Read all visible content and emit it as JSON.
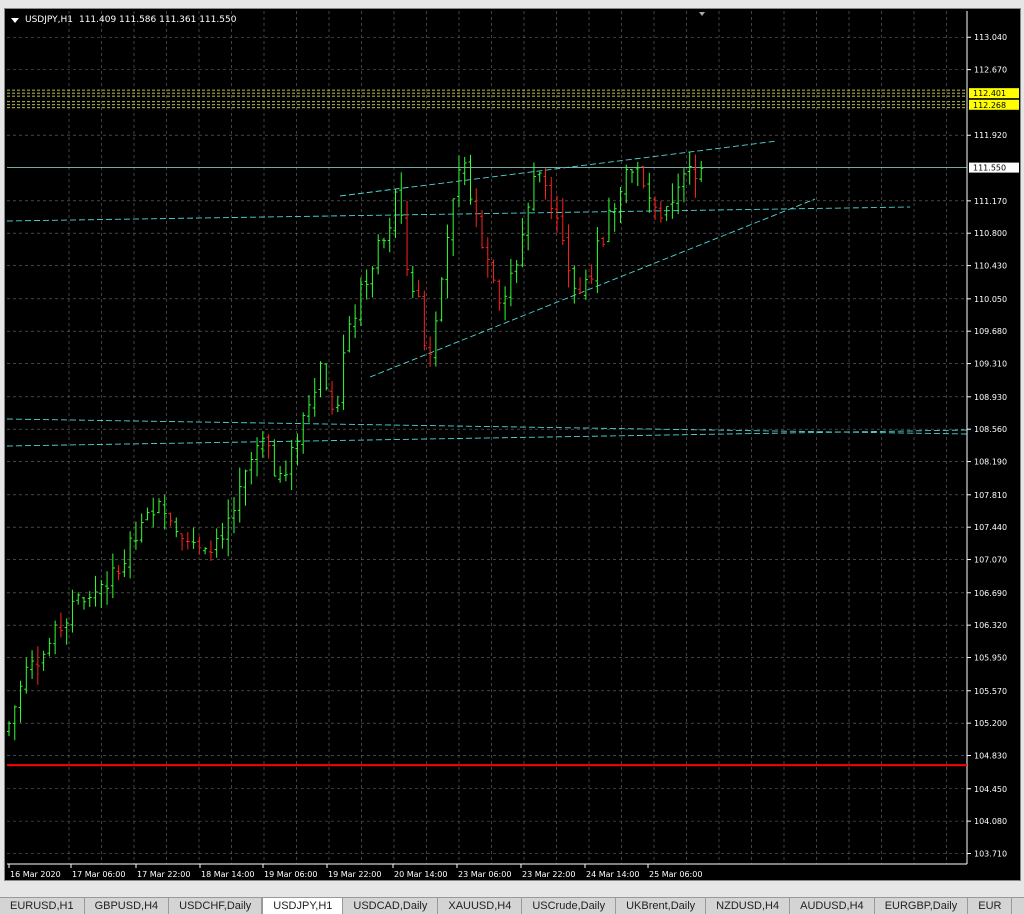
{
  "header": {
    "symbol": "USDJPY,H1",
    "ohlc": "111.409 111.586 111.361 111.550"
  },
  "colors": {
    "background": "#000000",
    "grid": "#6e6e6e",
    "bull": "#33ff33",
    "bear": "#ff2020",
    "trendline": "#4fd6d6",
    "bid_line": "#9ee0e0",
    "support_line": "#ff0000",
    "level_line": "#ffff66",
    "level_label_bg": "#ffff00"
  },
  "chart_data": {
    "type": "candlestick",
    "symbol": "USDJPY",
    "timeframe": "H1",
    "y_ticks": [
      "113.040",
      "112.670",
      "111.920",
      "111.170",
      "110.800",
      "110.430",
      "110.050",
      "109.680",
      "109.310",
      "108.930",
      "108.560",
      "108.190",
      "107.810",
      "107.440",
      "107.070",
      "106.690",
      "106.320",
      "105.950",
      "105.570",
      "105.200",
      "104.830",
      "104.450",
      "104.080",
      "103.710"
    ],
    "x_ticks": [
      "16 Mar 2020",
      "17 Mar 06:00",
      "17 Mar 22:00",
      "18 Mar 14:00",
      "19 Mar 06:00",
      "19 Mar 22:00",
      "20 Mar 14:00",
      "23 Mar 06:00",
      "23 Mar 22:00",
      "24 Mar 14:00",
      "25 Mar 06:00"
    ],
    "ylim": [
      103.59,
      113.34
    ],
    "current_price": "111.550",
    "price_levels": [
      "112.401",
      "112.268"
    ],
    "horizontal_red_line": 104.72,
    "close_path": [
      [
        0,
        105.2
      ],
      [
        3,
        105.8
      ],
      [
        6,
        106.0
      ],
      [
        9,
        106.3
      ],
      [
        11,
        106.6
      ],
      [
        14,
        106.6
      ],
      [
        16,
        106.8
      ],
      [
        19,
        106.9
      ],
      [
        21,
        107.2
      ],
      [
        23,
        107.4
      ],
      [
        26,
        107.8
      ],
      [
        28,
        107.6
      ],
      [
        30,
        107.4
      ],
      [
        32,
        107.2
      ],
      [
        34,
        107.1
      ],
      [
        36,
        107.3
      ],
      [
        38,
        107.5
      ],
      [
        40,
        107.8
      ],
      [
        42,
        108.2
      ],
      [
        44,
        108.4
      ],
      [
        46,
        108.1
      ],
      [
        48,
        108.0
      ],
      [
        50,
        108.5
      ],
      [
        52,
        108.9
      ],
      [
        54,
        109.3
      ],
      [
        55,
        109.1
      ],
      [
        56,
        108.7
      ],
      [
        57,
        108.9
      ],
      [
        58,
        109.4
      ],
      [
        60,
        109.9
      ],
      [
        62,
        110.3
      ],
      [
        64,
        110.6
      ],
      [
        66,
        110.8
      ],
      [
        67,
        111.3
      ],
      [
        68,
        110.9
      ],
      [
        69,
        110.4
      ],
      [
        71,
        110.0
      ],
      [
        72,
        109.6
      ],
      [
        73,
        109.4
      ],
      [
        74,
        109.9
      ],
      [
        75,
        110.4
      ],
      [
        76,
        110.8
      ],
      [
        77,
        111.1
      ],
      [
        78,
        111.4
      ],
      [
        79,
        111.5
      ],
      [
        80,
        111.3
      ],
      [
        81,
        111.0
      ],
      [
        82,
        110.7
      ],
      [
        83,
        110.5
      ],
      [
        84,
        110.3
      ],
      [
        85,
        110.1
      ],
      [
        86,
        110.0
      ],
      [
        87,
        110.3
      ],
      [
        88,
        110.5
      ],
      [
        89,
        110.8
      ],
      [
        90,
        111.1
      ],
      [
        91,
        111.4
      ],
      [
        92,
        111.5
      ],
      [
        93,
        111.4
      ],
      [
        94,
        111.2
      ],
      [
        95,
        110.9
      ],
      [
        96,
        110.6
      ],
      [
        97,
        110.4
      ],
      [
        98,
        110.2
      ],
      [
        99,
        110.1
      ],
      [
        100,
        110.3
      ],
      [
        101,
        110.4
      ],
      [
        102,
        110.6
      ],
      [
        103,
        110.7
      ],
      [
        104,
        111.0
      ],
      [
        105,
        111.2
      ],
      [
        106,
        111.4
      ],
      [
        107,
        111.5
      ],
      [
        108,
        111.6
      ],
      [
        109,
        111.5
      ],
      [
        110,
        111.3
      ],
      [
        111,
        111.2
      ],
      [
        112,
        111.0
      ],
      [
        113,
        110.9
      ],
      [
        114,
        111.0
      ],
      [
        115,
        111.2
      ],
      [
        116,
        111.4
      ],
      [
        117,
        111.4
      ],
      [
        118,
        111.5
      ],
      [
        119,
        111.4
      ],
      [
        120,
        111.55
      ]
    ]
  },
  "tabs": [
    {
      "label": "EURUSD,H1",
      "active": false
    },
    {
      "label": "GBPUSD,H4",
      "active": false
    },
    {
      "label": "USDCHF,Daily",
      "active": false
    },
    {
      "label": "USDJPY,H1",
      "active": true
    },
    {
      "label": "USDCAD,Daily",
      "active": false
    },
    {
      "label": "XAUUSD,H4",
      "active": false
    },
    {
      "label": "USCrude,Daily",
      "active": false
    },
    {
      "label": "UKBrent,Daily",
      "active": false
    },
    {
      "label": "NZDUSD,H4",
      "active": false
    },
    {
      "label": "AUDUSD,H4",
      "active": false
    },
    {
      "label": "EURGBP,Daily",
      "active": false
    },
    {
      "label": "EUR",
      "active": false
    }
  ]
}
